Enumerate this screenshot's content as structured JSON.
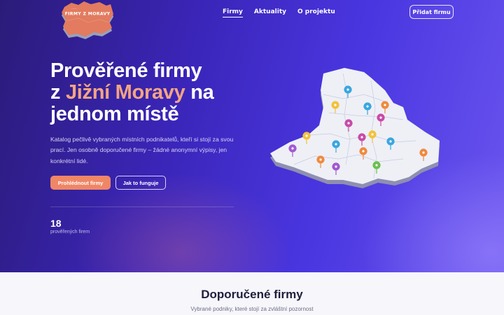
{
  "logo": {
    "text": "FIRMY Z MORAVY"
  },
  "nav": {
    "items": [
      "Firmy",
      "Aktuality",
      "O projektu"
    ],
    "cta": "Přidat firmu"
  },
  "hero": {
    "headline_1": "Prověřené firmy",
    "headline_2_pre": "z ",
    "headline_2_accent": "Jižní Moravy",
    "headline_2_post": " na",
    "headline_3": "jednom místě",
    "lead": "Katalog pečlivě vybraných místních podnikatelů, kteří si stojí za svou prací. Jen osobně doporučené firmy – žádné anonymní výpisy, jen konkrétní lidé.",
    "primary_button": "Prohlédnout firmy",
    "secondary_button": "Jak to funguje",
    "stat_value": "18",
    "stat_label": "prověřených firem"
  },
  "colors": {
    "accent": "#f4a483",
    "primary_button": "#ef8666",
    "hero_dark": "#2b1b78",
    "hero_light": "#6a55ef"
  },
  "section": {
    "title": "Doporučené firmy",
    "subtitle": "Vybrané podniky, které stojí za zvláštní pozornost"
  }
}
